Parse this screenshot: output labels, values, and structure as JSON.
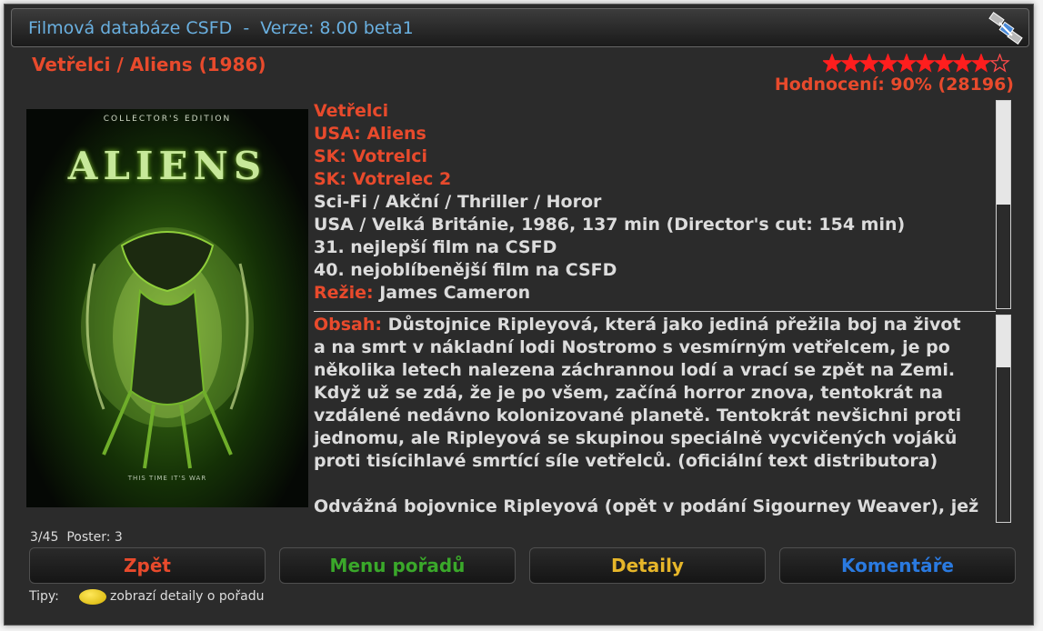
{
  "header": {
    "title": "Filmová databáze CSFD  -  Verze: 8.00 beta1",
    "icon": "satellite-icon"
  },
  "movie": {
    "title": "Vetřelci / Aliens (1986)",
    "rating_text": "Hodnocení: 90% (28196)",
    "stars_filled": 9,
    "stars_total": 10,
    "poster": {
      "edition_text": "COLLECTOR'S EDITION",
      "logo_text": "ALIENS",
      "tagline_text": "THIS TIME IT'S WAR"
    },
    "info_lines": [
      {
        "text": "Vetřelci",
        "style": "red"
      },
      {
        "text": "USA: Aliens",
        "style": "red"
      },
      {
        "text": "SK: Votrelci",
        "style": "red"
      },
      {
        "text": "SK: Votrelec 2",
        "style": "red"
      },
      {
        "text": "Sci-Fi / Akční / Thriller / Horor",
        "style": "normal"
      },
      {
        "text": "USA / Velká Británie, 1986, 137 min (Director's cut: 154 min)",
        "style": "normal"
      },
      {
        "text": "31. nejlepší film na CSFD",
        "style": "normal"
      },
      {
        "text": "40. nejoblíbenější film na CSFD",
        "style": "normal"
      }
    ],
    "director_label": "Režie:",
    "director": "James Cameron",
    "plot_label": "Obsah:",
    "plot_lines": [
      "Důstojnice Ripleyová, která jako jediná přežila boj na život",
      "a na smrt v nákladní lodi Nostromo s vesmírným vetřelcem, je po",
      "několika letech nalezena záchrannou lodí a vrací se zpět na Zemi.",
      "Když už se zdá, že je po všem, začíná horror znova, tentokrát na",
      "vzdálené nedávno kolonizované planetě. Tentokrát nevšichni proti",
      "jednomu, ale Ripleyová se skupinou speciálně vycvičených vojáků",
      "proti tisícihlavé smrtící síle vetřelců. (oficiální text distributora)",
      "",
      "Odvážná bojovnice Ripleyová (opět v podání Sigourney Weaver), jež"
    ]
  },
  "status": {
    "counter": "3/45  Poster: 3"
  },
  "buttons": [
    {
      "label": "Zpět",
      "color": "#e84a2c"
    },
    {
      "label": "Menu pořadů",
      "color": "#3aa82a"
    },
    {
      "label": "Detaily",
      "color": "#e6b62a"
    },
    {
      "label": "Komentáře",
      "color": "#2a7ae0"
    }
  ],
  "tips": {
    "label": "Tipy:",
    "text": "zobrazí detaily o pořadu"
  },
  "scroll": {
    "info_fraction": 0.5,
    "plot_fraction": 0.25
  }
}
